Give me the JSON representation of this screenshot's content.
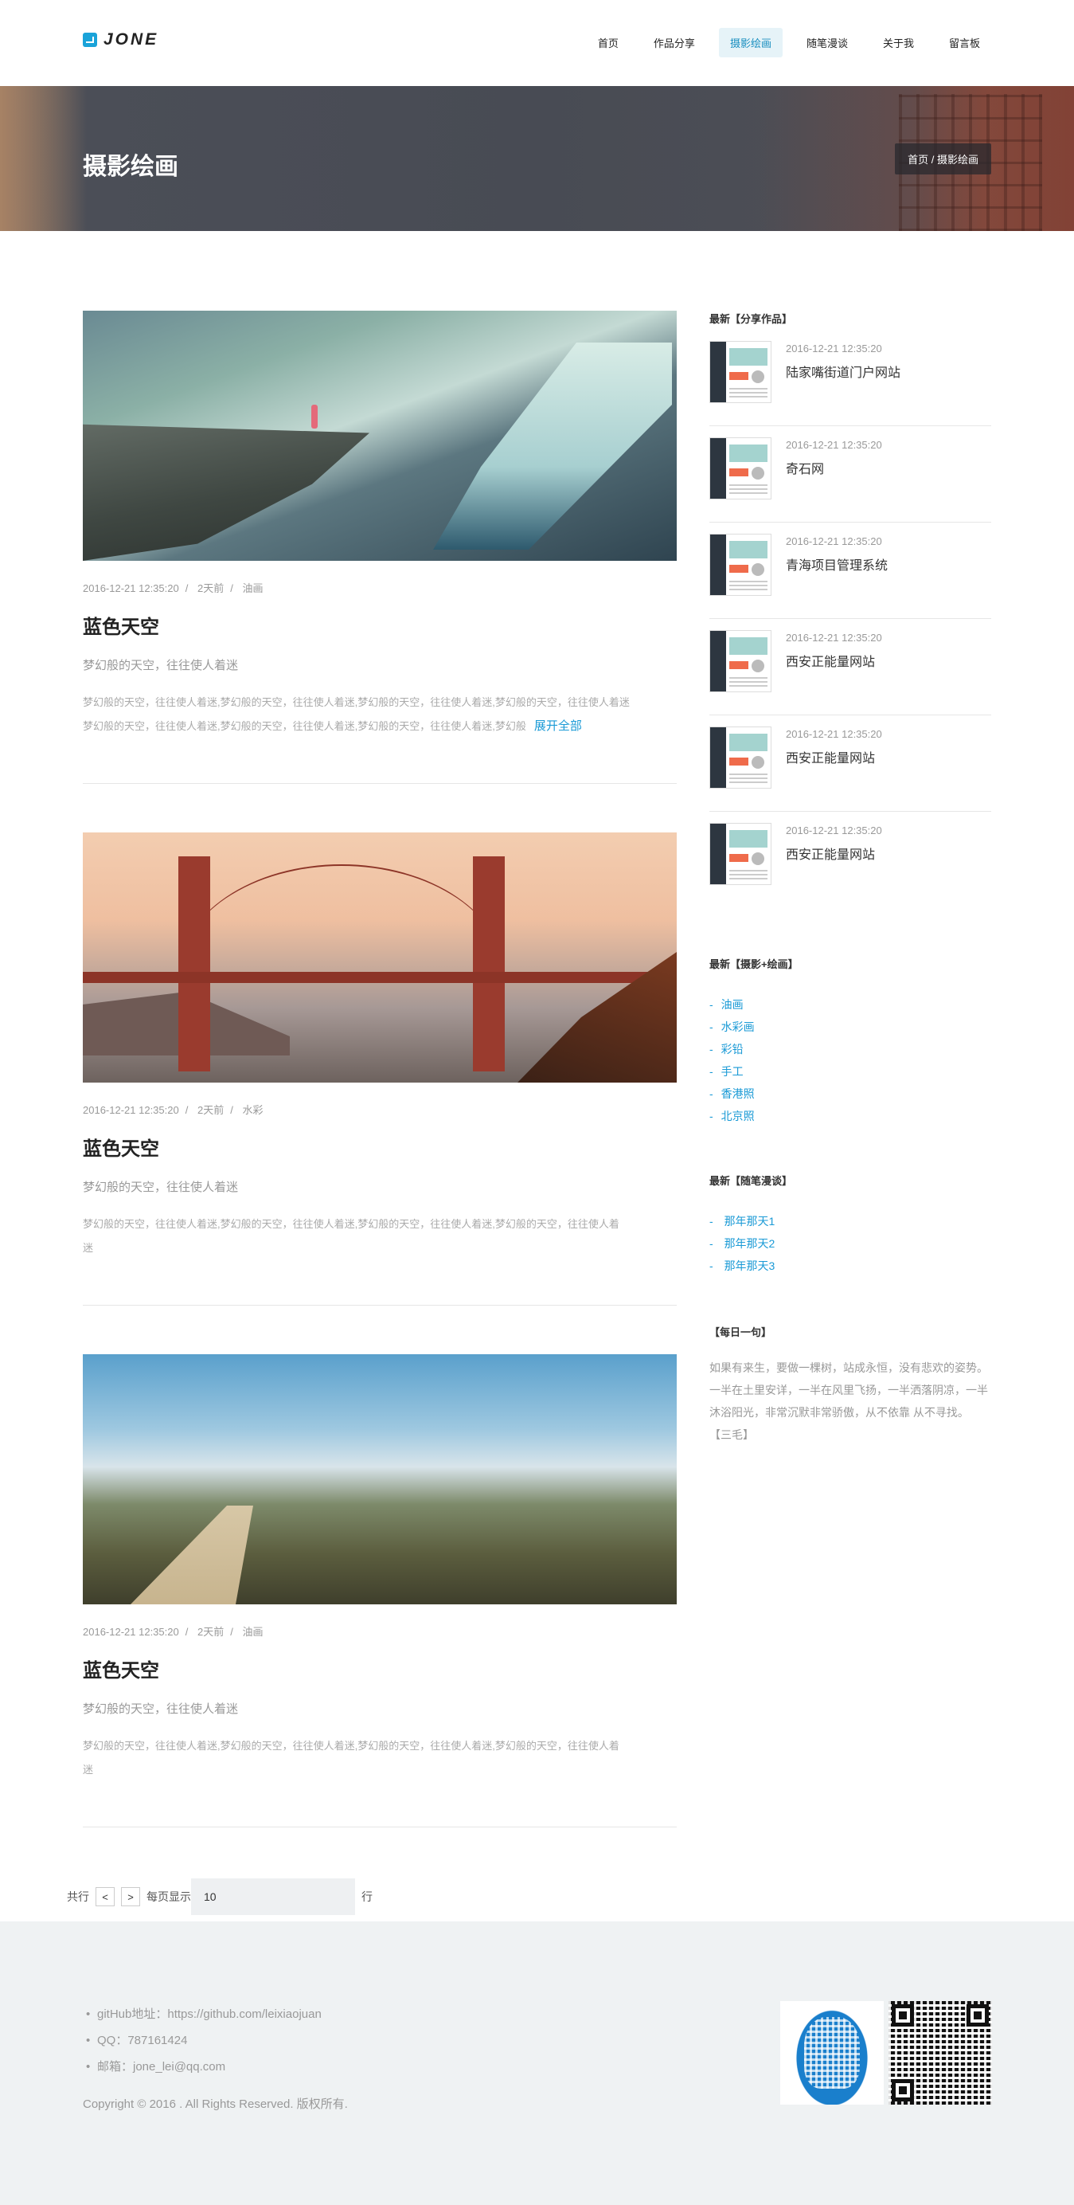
{
  "header": {
    "logo_text": "JONE",
    "nav": [
      {
        "label": "首页"
      },
      {
        "label": "作品分享"
      },
      {
        "label": "摄影绘画",
        "active": true
      },
      {
        "label": "随笔漫谈"
      },
      {
        "label": "关于我"
      },
      {
        "label": "留言板"
      }
    ]
  },
  "banner": {
    "title": "摄影绘画",
    "breadcrumb": "首页 / 摄影绘画"
  },
  "posts": [
    {
      "date": "2016-12-21 12:35:20",
      "ago": "2天前",
      "category": "油画",
      "title": "蓝色天空",
      "subtitle": "梦幻般的天空，往往使人着迷",
      "body_line1": "梦幻般的天空，往往使人着迷,梦幻般的天空，往往使人着迷,梦幻般的天空，往往使人着迷,梦幻般的天空，往往使人着迷",
      "body_line2": "梦幻般的天空，往往使人着迷,梦幻般的天空，往往使人着迷,梦幻般的天空，往往使人着迷,梦幻般",
      "expand": "展开全部"
    },
    {
      "date": "2016-12-21 12:35:20",
      "ago": "2天前",
      "category": "水彩",
      "title": "蓝色天空",
      "subtitle": "梦幻般的天空，往往使人着迷",
      "body_line1": "梦幻般的天空，往往使人着迷,梦幻般的天空，往往使人着迷,梦幻般的天空，往往使人着迷,梦幻般的天空，往往使人着",
      "body_line2": "迷"
    },
    {
      "date": "2016-12-21 12:35:20",
      "ago": "2天前",
      "category": "油画",
      "title": "蓝色天空",
      "subtitle": "梦幻般的天空，往往使人着迷",
      "body_line1": "梦幻般的天空，往往使人着迷,梦幻般的天空，往往使人着迷,梦幻般的天空，往往使人着迷,梦幻般的天空，往往使人着",
      "body_line2": "迷"
    }
  ],
  "sidebar": {
    "works_heading": "最新【分享作品】",
    "works": [
      {
        "date": "2016-12-21 12:35:20",
        "title": "陆家嘴街道门户网站"
      },
      {
        "date": "2016-12-21 12:35:20",
        "title": "奇石网"
      },
      {
        "date": "2016-12-21 12:35:20",
        "title": "青海项目管理系统"
      },
      {
        "date": "2016-12-21 12:35:20",
        "title": "西安正能量网站"
      },
      {
        "date": "2016-12-21 12:35:20",
        "title": "西安正能量网站"
      },
      {
        "date": "2016-12-21 12:35:20",
        "title": "西安正能量网站"
      }
    ],
    "photo_heading": "最新【摄影+绘画】",
    "photo_links": [
      "油画",
      "水彩画",
      "彩铅",
      "手工",
      "香港照",
      "北京照"
    ],
    "essay_heading": "最新【随笔漫谈】",
    "essay_links": [
      "那年那天1",
      "那年那天2",
      "那年那天3"
    ],
    "quote_heading": "【每日一句】",
    "quote": "如果有来生，要做一棵树，站成永恒，没有悲欢的姿势。一半在土里安详，一半在风里飞扬，一半洒落阴凉，一半沐浴阳光，非常沉默非常骄傲，从不依靠 从不寻找。 【三毛】"
  },
  "pager": {
    "total_label": "共行",
    "prev": "<",
    "next": ">",
    "per_page_label": "每页显示",
    "per_page_value": "10",
    "rows_suffix": "行"
  },
  "footer": {
    "github": "gitHub地址：https://github.com/leixiaojuan",
    "qq": "QQ：787161424",
    "email": "邮箱：jone_lei@qq.com",
    "copyright": "Copyright © 2016 . All Rights Reserved. 版权所有."
  }
}
